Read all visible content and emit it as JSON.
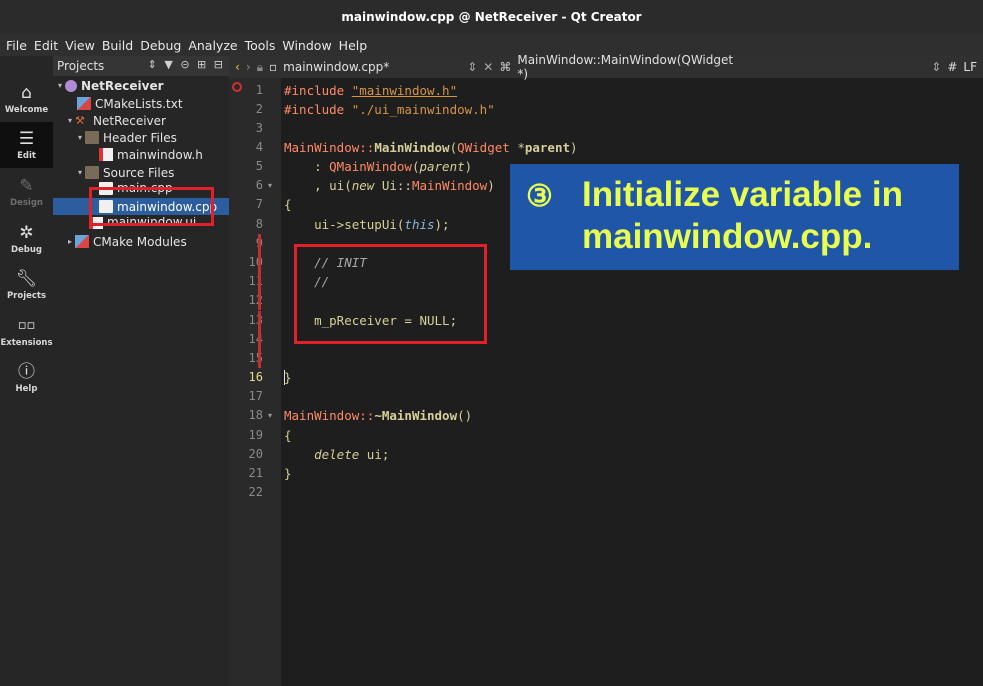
{
  "window": {
    "title": "mainwindow.cpp @ NetReceiver - Qt Creator"
  },
  "menu": [
    "File",
    "Edit",
    "View",
    "Build",
    "Debug",
    "Analyze",
    "Tools",
    "Window",
    "Help"
  ],
  "modes": [
    {
      "label": "Welcome",
      "icon": "home-icon"
    },
    {
      "label": "Edit",
      "icon": "edit-icon"
    },
    {
      "label": "Design",
      "icon": "design-icon"
    },
    {
      "label": "Debug",
      "icon": "debug-icon"
    },
    {
      "label": "Projects",
      "icon": "wrench-icon"
    },
    {
      "label": "Extensions",
      "icon": "extensions-icon"
    },
    {
      "label": "Help",
      "icon": "help-icon"
    }
  ],
  "projects": {
    "header": "Projects",
    "tree": [
      {
        "label": "NetReceiver",
        "depth": 0,
        "icon": "project-icon",
        "arrow": "▾",
        "bold": true
      },
      {
        "label": "CMakeLists.txt",
        "depth": 1,
        "icon": "cmake-icon",
        "arrow": ""
      },
      {
        "label": "NetReceiver",
        "depth": 1,
        "icon": "hammer-icon",
        "arrow": "▾"
      },
      {
        "label": "Header Files",
        "depth": 2,
        "icon": "folder-icon",
        "arrow": "▾"
      },
      {
        "label": "mainwindow.h",
        "depth": 3,
        "icon": "header-file-icon",
        "arrow": ""
      },
      {
        "label": "Source Files",
        "depth": 2,
        "icon": "folder-icon",
        "arrow": "▾"
      },
      {
        "label": "main.cpp",
        "depth": 3,
        "icon": "cpp-file-icon",
        "arrow": ""
      },
      {
        "label": "mainwindow.cpp",
        "depth": 3,
        "icon": "cpp-file-icon",
        "arrow": "",
        "selected": true
      },
      {
        "label": "mainwindow.ui",
        "depth": 2,
        "icon": "ui-file-icon",
        "arrow": ""
      },
      {
        "label": "CMake Modules",
        "depth": 1,
        "icon": "cmake-modules-icon",
        "arrow": "▸"
      }
    ]
  },
  "editor": {
    "tab_label": "mainwindow.cpp*",
    "symbol": "MainWindow::MainWindow(QWidget *)",
    "line_ending": "LF",
    "hash": "#",
    "current_line": "16",
    "line_numbers": [
      "1",
      "2",
      "3",
      "4",
      "5",
      "6",
      "7",
      "8",
      "9",
      "10",
      "11",
      "12",
      "13",
      "14",
      "15",
      "16",
      "17",
      "18",
      "19",
      "20",
      "21",
      "22"
    ],
    "code": {
      "l1a": "#include ",
      "l1b": "\"mainwindow.h\"",
      "l2a": "#include ",
      "l2b": "\"./ui_mainwindow.h\"",
      "l4a": "MainWindow::",
      "l4b": "MainWindow",
      "l4c": "(",
      "l4d": "QWidget",
      "l4e": " *",
      "l4f": "parent",
      "l4g": ")",
      "l5a": "    : ",
      "l5b": "QMainWindow",
      "l5c": "(",
      "l5d": "parent",
      "l5e": ")",
      "l6a": "    , ui(",
      "l6b": "new",
      "l6c": " Ui::",
      "l6d": "MainWindow",
      "l6e": ")",
      "l7": "{",
      "l8a": "    ui->setupUi(",
      "l8b": "this",
      "l8c": ");",
      "l10": "    // INIT",
      "l11": "    //",
      "l13": "    m_pReceiver = NULL;",
      "l16": "}",
      "l18a": "MainWindow::",
      "l18b": "~MainWindow",
      "l18c": "()",
      "l19": "{",
      "l20a": "    ",
      "l20b": "delete",
      "l20c": " ui;",
      "l21": "}"
    }
  },
  "callout": {
    "number": "③",
    "text": "Initialize variable in mainwindow.cpp.",
    "background": "#1f56a8",
    "color": "#e8ff50"
  },
  "colors": {
    "highlight_box": "#e0202a",
    "selection": "#2c5d9f"
  }
}
